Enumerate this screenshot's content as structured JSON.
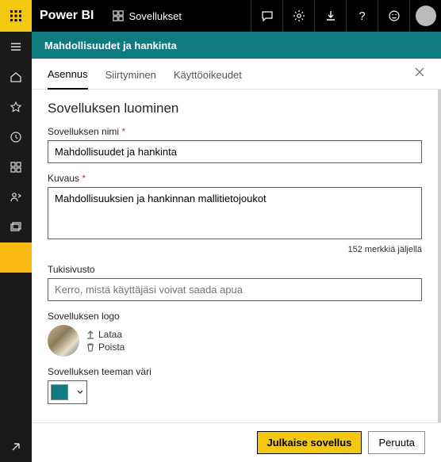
{
  "header": {
    "brand": "Power BI",
    "workspace_label": "Sovellukset"
  },
  "subheader": {
    "title": "Mahdollisuudet ja hankinta"
  },
  "tabs": {
    "setup": "Asennus",
    "navigation": "Siirtyminen",
    "permissions": "Käyttöoikeudet"
  },
  "panel": {
    "title": "Sovelluksen luominen",
    "app_name_label": "Sovelluksen nimi",
    "app_name_value": "Mahdollisuudet ja hankinta",
    "description_label": "Kuvaus",
    "description_value": "Mahdollisuuksien ja hankinnan mallitietojoukot",
    "chars_remaining": "152 merkkiä jäljellä",
    "support_label": "Tukisivusto",
    "support_placeholder": "Kerro, mistä käyttäjäsi voivat saada apua",
    "logo_label": "Sovelluksen logo",
    "logo_upload": "Lataa",
    "logo_delete": "Poista",
    "theme_label": "Sovelluksen teeman väri",
    "theme_color": "#0f7b80"
  },
  "footer": {
    "publish": "Julkaise sovellus",
    "cancel": "Peruuta"
  }
}
